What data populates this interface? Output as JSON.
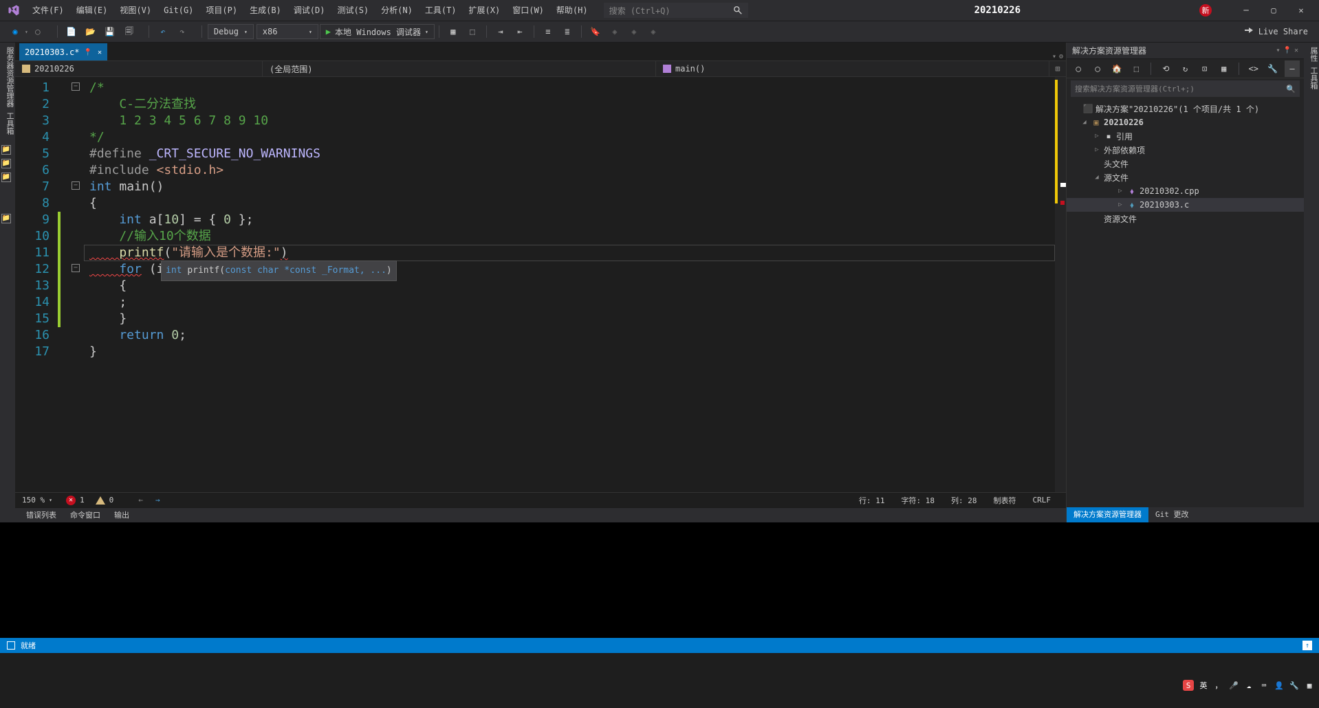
{
  "menu": {
    "file": "文件(F)",
    "edit": "编辑(E)",
    "view": "视图(V)",
    "git": "Git(G)",
    "project": "项目(P)",
    "build": "生成(B)",
    "debug": "调试(D)",
    "test": "测试(S)",
    "analyze": "分析(N)",
    "tools": "工具(T)",
    "extensions": "扩展(X)",
    "window": "窗口(W)",
    "help": "帮助(H)"
  },
  "search_placeholder": "搜索 (Ctrl+Q)",
  "solution_name": "20210226",
  "notif_badge": "新",
  "toolbar": {
    "config": "Debug",
    "platform": "x86",
    "debugger": "本地 Windows 调试器"
  },
  "liveshare": "Live Share",
  "left_rail": "服务器资源管理器  工具箱",
  "right_rail": "属性 工具箱",
  "tab": {
    "name": "20210303.c*"
  },
  "nav": {
    "scope": "20210226",
    "context": "(全局范围)",
    "func": "main()"
  },
  "code": {
    "l1": "/*",
    "l2": "    C-二分法查找",
    "l3": "    1 2 3 4 5 6 7 8 9 10",
    "l4": "*/",
    "l5a": "#define ",
    "l5b": "_CRT_SECURE_NO_WARNINGS",
    "l6a": "#include ",
    "l6b": "<stdio.h>",
    "l7a": "int",
    "l7b": " main()",
    "l8": "{",
    "l9a": "    int",
    "l9b": " a[",
    "l9c": "10",
    "l9d": "] = { ",
    "l9e": "0",
    "l9f": " };",
    "l10": "    //输入10个数据",
    "l11a": "    printf",
    "l11b": "(",
    "l11c": "\"请输入是个数据:\"",
    "l11d": ")",
    "l12a": "    for",
    "l12b": " (in",
    "l13": "    {",
    "l14": "    ;",
    "l15": "    }",
    "l16a": "    return ",
    "l16b": "0",
    "l16c": ";",
    "l17": "}"
  },
  "linenums": [
    "1",
    "2",
    "3",
    "4",
    "5",
    "6",
    "7",
    "8",
    "9",
    "10",
    "11",
    "12",
    "13",
    "14",
    "15",
    "16",
    "17"
  ],
  "tooltip": {
    "pre": "int ",
    "fn": "printf(",
    "p1": "const char *const _Format, ...",
    ")": ""
  },
  "sol": {
    "title": "解决方案资源管理器",
    "search": "搜索解决方案资源管理器(Ctrl+;)",
    "root": "解决方案\"20210226\"(1 个项目/共 1 个)",
    "proj": "20210226",
    "refs": "引用",
    "ext": "外部依赖项",
    "hdr": "头文件",
    "src": "源文件",
    "f1": "20210302.cpp",
    "f2": "20210303.c",
    "res": "资源文件"
  },
  "soltabs": {
    "explorer": "解决方案资源管理器",
    "git": "Git 更改"
  },
  "edstatus": {
    "zoom": "150 %",
    "err": "1",
    "warn": "0",
    "line": "行: 11",
    "col": "字符: 18",
    "colpos": "列: 28",
    "mode": "制表符",
    "eol": "CRLF"
  },
  "bottomtabs": {
    "errlist": "错误列表",
    "cmdwin": "命令窗口",
    "output": "输出"
  },
  "statusbar": {
    "ready": "就绪"
  },
  "tray": {
    "ime": "英"
  }
}
